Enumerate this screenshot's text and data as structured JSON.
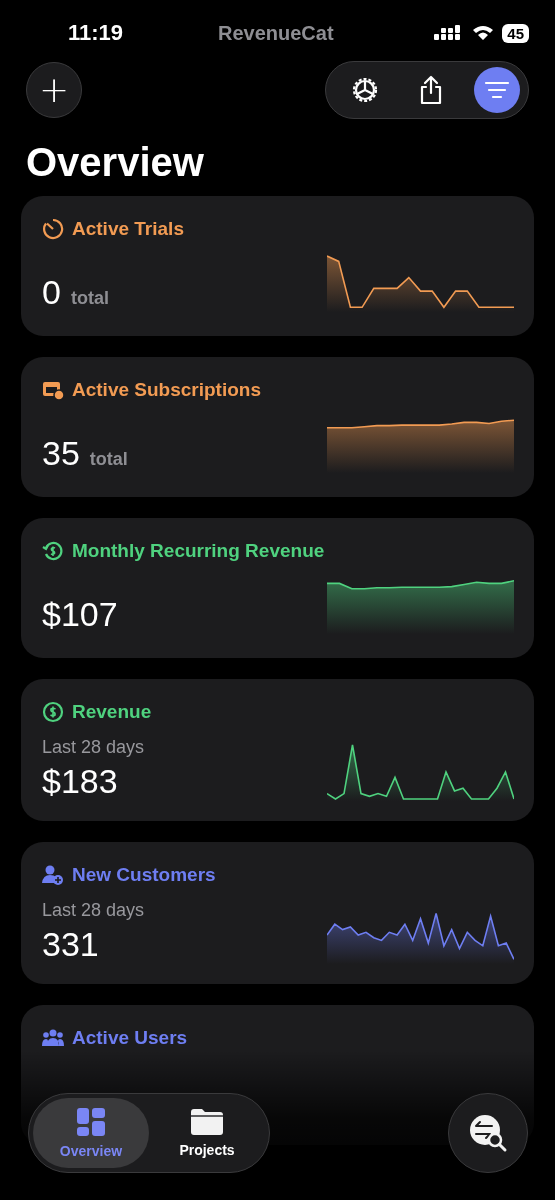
{
  "status_bar": {
    "time": "11:19",
    "carrier_logo": "RevenueCat",
    "battery": "45"
  },
  "header": {
    "add_button": "+",
    "actions": [
      {
        "kind": "gear",
        "selected": false
      },
      {
        "kind": "share",
        "selected": false
      },
      {
        "kind": "filter",
        "selected": true
      }
    ]
  },
  "title": "Overview",
  "cards": [
    {
      "kind": "timer",
      "title": "Active Trials",
      "color": "#f29b53",
      "value": "0",
      "unit": "total"
    },
    {
      "kind": "calendar",
      "title": "Active Subscriptions",
      "color": "#f29b53",
      "value": "35",
      "unit": "total"
    },
    {
      "kind": "refresh-dollar",
      "title": "Monthly Recurring Revenue",
      "color": "#4fd27f",
      "value": "$107"
    },
    {
      "kind": "dollar",
      "title": "Revenue",
      "color": "#4fd27f",
      "subtitle": "Last 28 days",
      "value": "$183"
    },
    {
      "kind": "person-add",
      "title": "New Customers",
      "color": "#6e7ef2",
      "subtitle": "Last 28 days",
      "value": "331"
    },
    {
      "kind": "people",
      "title": "Active Users",
      "color": "#6e7ef2"
    }
  ],
  "tab_bar": {
    "tabs": [
      {
        "kind": "overview",
        "label": "Overview",
        "selected": true
      },
      {
        "kind": "projects",
        "label": "Projects",
        "selected": false
      }
    ]
  }
}
